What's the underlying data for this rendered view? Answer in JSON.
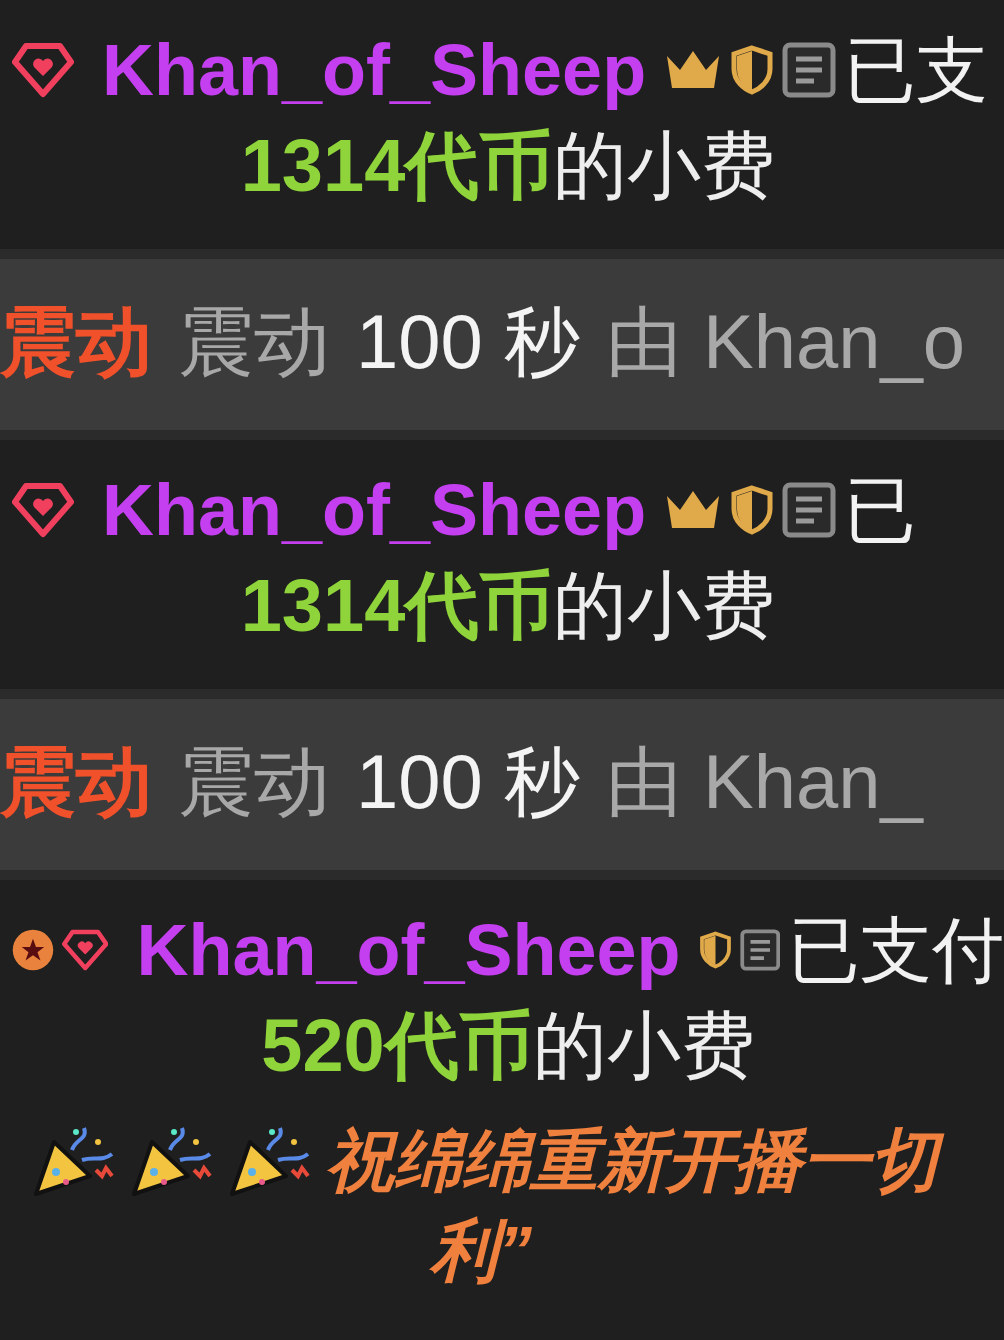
{
  "feed": [
    {
      "kind": "tip",
      "badges": [
        {
          "kind": "gem"
        },
        {
          "kind": "crown"
        },
        {
          "kind": "shield"
        }
      ],
      "username": "Khan_of_Sheep",
      "paid": "已支",
      "amount": "1314代币",
      "suffix": "的小费"
    },
    {
      "kind": "vibration",
      "mode": "震动",
      "label": "震动",
      "duration": "100 秒",
      "by": "由 Khan_o"
    },
    {
      "kind": "tip",
      "badges": [
        {
          "kind": "gem"
        },
        {
          "kind": "crown"
        },
        {
          "kind": "shield"
        }
      ],
      "username": "Khan_of_Sheep",
      "paid": "已",
      "amount": "1314代币",
      "suffix": "的小费"
    },
    {
      "kind": "vibration",
      "mode": "震动",
      "label": "震动",
      "duration": "100 秒",
      "by": "由 Khan_"
    },
    {
      "kind": "tip",
      "badges": [
        {
          "kind": "star"
        },
        {
          "kind": "gem"
        },
        {
          "kind": "shield"
        }
      ],
      "username": "Khan_of_Sheep",
      "paid": "已支付",
      "amount": "520代币",
      "suffix": "的小费",
      "message": {
        "icons": [
          {
            "kind": "party-popper"
          },
          {
            "kind": "party-popper"
          },
          {
            "kind": "party-popper"
          }
        ],
        "lines": [
          "祝绵绵重新开播一切",
          "利”"
        ]
      }
    }
  ]
}
